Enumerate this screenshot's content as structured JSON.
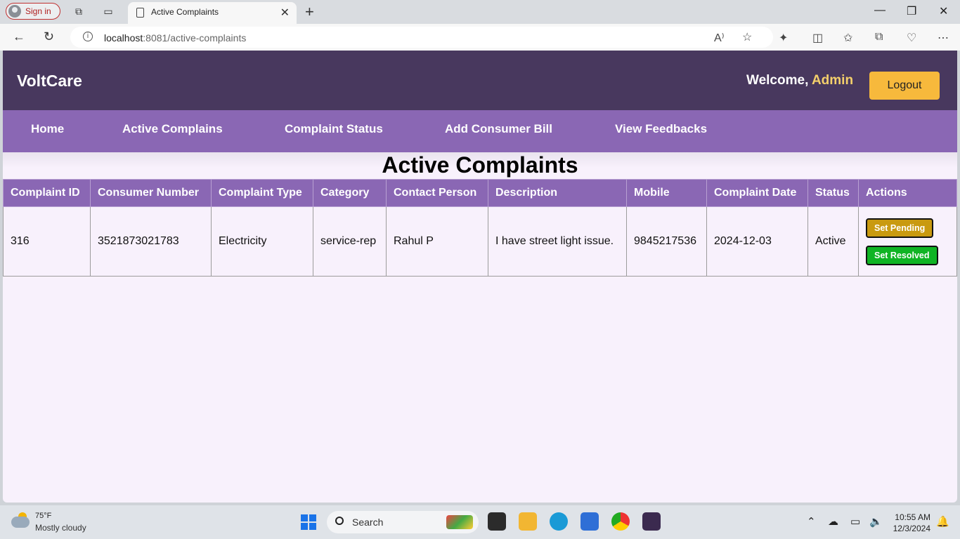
{
  "browser": {
    "signin_label": "Sign in",
    "tab_title": "Active Complaints",
    "url_host": "localhost",
    "url_rest": ":8081/active-complaints"
  },
  "header": {
    "brand": "VoltCare",
    "welcome_prefix": "Welcome,",
    "user": "Admin",
    "logout_label": "Logout"
  },
  "nav": {
    "items": [
      "Home",
      "Active Complains",
      "Complaint Status",
      "Add Consumer Bill",
      "View Feedbacks"
    ]
  },
  "main": {
    "title": "Active Complaints",
    "columns": [
      "Complaint ID",
      "Consumer Number",
      "Complaint Type",
      "Category",
      "Contact Person",
      "Description",
      "Mobile",
      "Complaint Date",
      "Status",
      "Actions"
    ],
    "rows": [
      {
        "id": "316",
        "consumer_number": "3521873021783",
        "type": "Electricity",
        "category": "service-rep",
        "contact": "Rahul P",
        "description": "I have street light issue.",
        "mobile": "9845217536",
        "date": "2024-12-03",
        "status": "Active",
        "action_pending": "Set Pending",
        "action_resolved": "Set Resolved"
      }
    ]
  },
  "taskbar": {
    "temperature": "75°F",
    "weather": "Mostly cloudy",
    "search_placeholder": "Search",
    "time": "10:55 AM",
    "date": "12/3/2024"
  },
  "colors": {
    "header_bg": "#48385e",
    "nav_bg": "#8a67b4",
    "logout_bg": "#f7b93c",
    "pending_bg": "#c99a10",
    "resolved_bg": "#10b424",
    "page_bg": "#f8f1fc"
  }
}
